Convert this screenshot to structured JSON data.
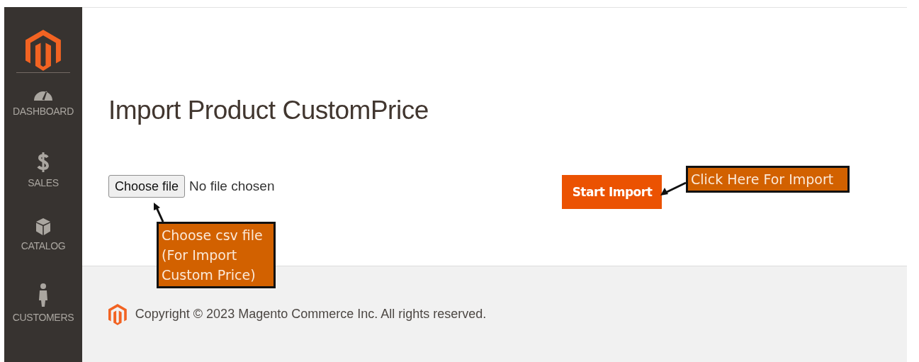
{
  "sidebar": {
    "items": [
      {
        "label": "DASHBOARD",
        "kind": "gauge"
      },
      {
        "label": "SALES",
        "kind": "dollar"
      },
      {
        "label": "CATALOG",
        "kind": "box"
      },
      {
        "label": "CUSTOMERS",
        "kind": "person"
      }
    ]
  },
  "page": {
    "title": "Import Product CustomPrice"
  },
  "file_input": {
    "button": "Choose file",
    "status": "No file chosen"
  },
  "import_button": "Start Import",
  "callouts": [
    {
      "kind": "below",
      "lines": [
        "Choose csv file",
        "(For Import",
        "Custom Price)"
      ]
    },
    {
      "kind": "right",
      "lines": [
        "Click Here For Import"
      ]
    }
  ],
  "footer": {
    "copyright": "Copyright © 2023 Magento Commerce Inc. All rights reserved."
  }
}
